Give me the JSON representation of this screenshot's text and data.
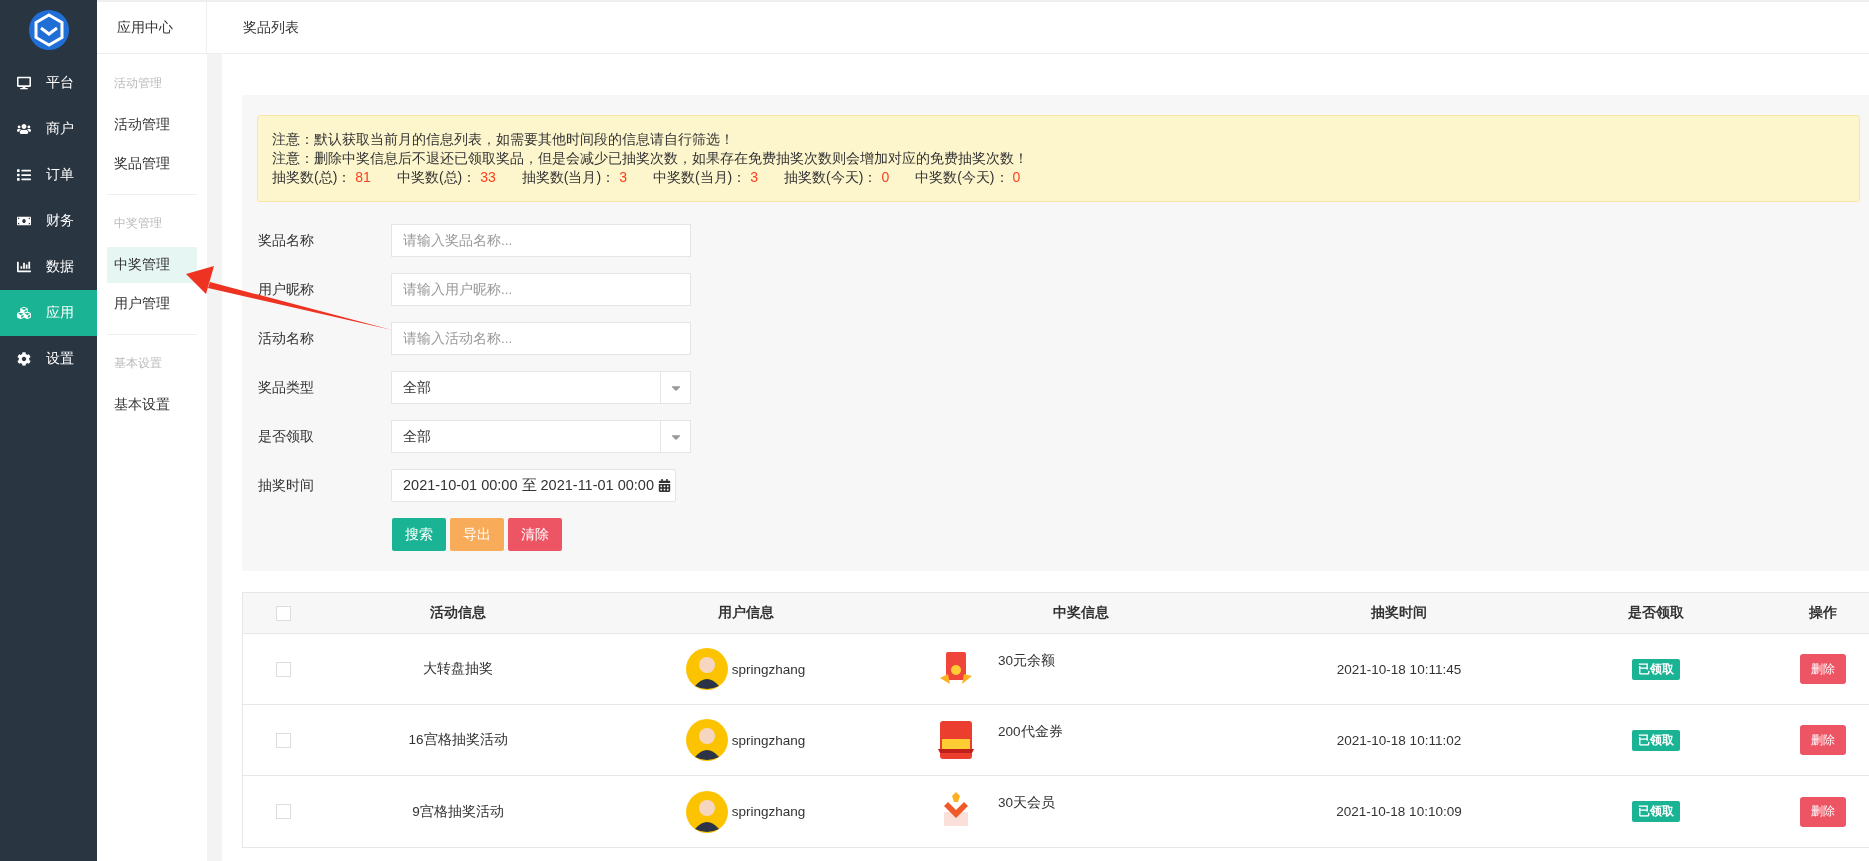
{
  "sidebar": {
    "items": [
      {
        "label": "平台",
        "kind": "monitor",
        "selected": false
      },
      {
        "label": "商户",
        "kind": "users",
        "selected": false
      },
      {
        "label": "订单",
        "kind": "list",
        "selected": false
      },
      {
        "label": "财务",
        "kind": "money",
        "selected": false
      },
      {
        "label": "数据",
        "kind": "chart",
        "selected": false
      },
      {
        "label": "应用",
        "kind": "cubes",
        "selected": true
      },
      {
        "label": "设置",
        "kind": "gear",
        "selected": false
      }
    ]
  },
  "header": {
    "section": "应用中心",
    "page": "奖品列表"
  },
  "subnav": {
    "groups": [
      {
        "title": "活动管理",
        "items": [
          {
            "label": "活动管理",
            "selected": false
          },
          {
            "label": "奖品管理",
            "selected": false
          }
        ]
      },
      {
        "title": "中奖管理",
        "items": [
          {
            "label": "中奖管理",
            "selected": true
          },
          {
            "label": "用户管理",
            "selected": false
          }
        ]
      },
      {
        "title": "基本设置",
        "items": [
          {
            "label": "基本设置",
            "selected": false
          }
        ]
      }
    ]
  },
  "notice": {
    "lines": [
      "注意：默认获取当前月的信息列表，如需要其他时间段的信息请自行筛选！",
      "注意：删除中奖信息后不退还已领取奖品，但是会减少已抽奖次数，如果存在免费抽奖次数则会增加对应的免费抽奖次数！"
    ],
    "stats": [
      {
        "label": "抽奖数(总)：",
        "value": "81"
      },
      {
        "label": "中奖数(总)：",
        "value": "33"
      },
      {
        "label": "抽奖数(当月)：",
        "value": "3"
      },
      {
        "label": "中奖数(当月)：",
        "value": "3"
      },
      {
        "label": "抽奖数(今天)：",
        "value": "0"
      },
      {
        "label": "中奖数(今天)：",
        "value": "0"
      }
    ]
  },
  "filters": [
    {
      "label": "奖品名称",
      "kind": "text",
      "placeholder": "请输入奖品名称..."
    },
    {
      "label": "用户昵称",
      "kind": "text",
      "placeholder": "请输入用户昵称..."
    },
    {
      "label": "活动名称",
      "kind": "text",
      "placeholder": "请输入活动名称..."
    },
    {
      "label": "奖品类型",
      "kind": "select",
      "value": "全部"
    },
    {
      "label": "是否领取",
      "kind": "select",
      "value": "全部"
    },
    {
      "label": "抽奖时间",
      "kind": "daterange",
      "value": "2021-10-01 00:00 至 2021-11-01 00:00"
    }
  ],
  "actions": [
    {
      "label": "搜索",
      "kind": "primary"
    },
    {
      "label": "导出",
      "kind": "warning"
    },
    {
      "label": "清除",
      "kind": "danger"
    }
  ],
  "table": {
    "select_all": false,
    "columns": [
      "活动信息",
      "用户信息",
      "中奖信息",
      "抽奖时间",
      "是否领取",
      "操作"
    ],
    "rows": [
      {
        "checked": false,
        "activity": "大转盘抽奖",
        "user": "springzhang",
        "prize": "30元余额",
        "kind": "balance",
        "time": "2021-10-18 10:11:45",
        "status": "已领取",
        "claimed": true,
        "action": "删除"
      },
      {
        "checked": false,
        "activity": "16宫格抽奖活动",
        "user": "springzhang",
        "prize": "200代金券",
        "kind": "voucher",
        "time": "2021-10-18 10:11:02",
        "status": "已领取",
        "claimed": true,
        "action": "删除"
      },
      {
        "checked": false,
        "activity": "9宫格抽奖活动",
        "user": "springzhang",
        "prize": "30天会员",
        "kind": "membership",
        "time": "2021-10-18 10:10:09",
        "status": "已领取",
        "claimed": true,
        "action": "删除"
      }
    ]
  }
}
